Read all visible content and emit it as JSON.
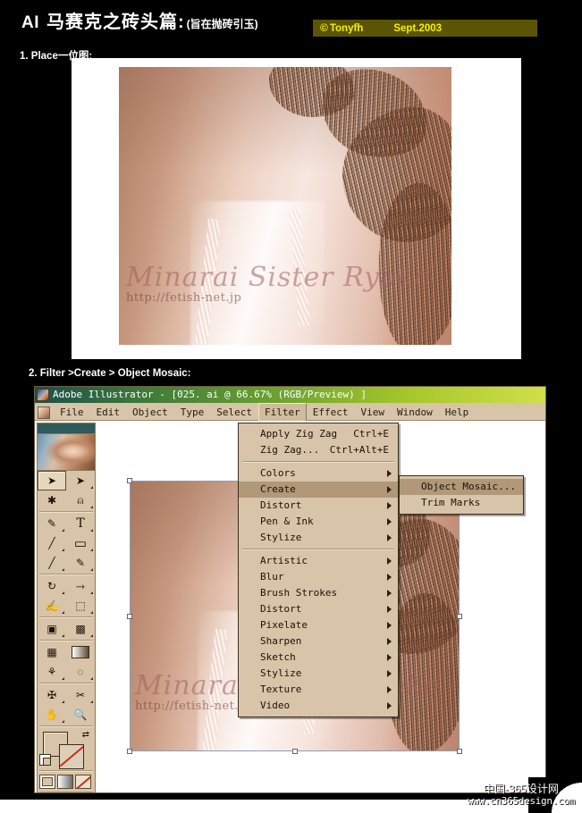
{
  "header": {
    "ai_tag": "AI",
    "title_cn": "马赛克之砖头篇:",
    "subtitle_cn": "(旨在抛砖引玉)",
    "copyright_mark": "©",
    "copyright_owner": "Tonyfh",
    "copyright_date": "Sept.2003",
    "badge_bg": "#5b5405",
    "badge_fg": "#f5f000"
  },
  "sections": {
    "step1_label": "1. Place一位图:",
    "step2_label": "2. Filter >Create > Object  Mosaic:"
  },
  "photo": {
    "watermark_name": "Minarai Sister Ryoko",
    "watermark_url": "http://fetish-net.jp"
  },
  "ai_window": {
    "title": "Adobe Illustrator - [025. ai @ 66.67% (RGB/Preview) ]",
    "titlebar_gradient_start": "#1d4f4a",
    "titlebar_gradient_end": "#cfe04a",
    "menubar": [
      {
        "label": "File",
        "active": false
      },
      {
        "label": "Edit",
        "active": false
      },
      {
        "label": "Object",
        "active": false
      },
      {
        "label": "Type",
        "active": false
      },
      {
        "label": "Select",
        "active": false
      },
      {
        "label": "Filter",
        "active": true
      },
      {
        "label": "Effect",
        "active": false
      },
      {
        "label": "View",
        "active": false
      },
      {
        "label": "Window",
        "active": false
      },
      {
        "label": "Help",
        "active": false
      }
    ],
    "zoom_level": "66.67%",
    "document_name": "025. ai",
    "color_mode": "RGB/Preview"
  },
  "filter_menu": {
    "groups": [
      [
        {
          "label": "Apply Zig Zag",
          "shortcut": "Ctrl+E",
          "submenu": false,
          "highlighted": false
        },
        {
          "label": "Zig Zag...",
          "shortcut": "Ctrl+Alt+E",
          "submenu": false,
          "highlighted": false
        }
      ],
      [
        {
          "label": "Colors",
          "shortcut": "",
          "submenu": true,
          "highlighted": false
        },
        {
          "label": "Create",
          "shortcut": "",
          "submenu": true,
          "highlighted": true
        },
        {
          "label": "Distort",
          "shortcut": "",
          "submenu": true,
          "highlighted": false
        },
        {
          "label": "Pen & Ink",
          "shortcut": "",
          "submenu": true,
          "highlighted": false
        },
        {
          "label": "Stylize",
          "shortcut": "",
          "submenu": true,
          "highlighted": false
        }
      ],
      [
        {
          "label": "Artistic",
          "shortcut": "",
          "submenu": true,
          "highlighted": false
        },
        {
          "label": "Blur",
          "shortcut": "",
          "submenu": true,
          "highlighted": false
        },
        {
          "label": "Brush Strokes",
          "shortcut": "",
          "submenu": true,
          "highlighted": false
        },
        {
          "label": "Distort",
          "shortcut": "",
          "submenu": true,
          "highlighted": false
        },
        {
          "label": "Pixelate",
          "shortcut": "",
          "submenu": true,
          "highlighted": false
        },
        {
          "label": "Sharpen",
          "shortcut": "",
          "submenu": true,
          "highlighted": false
        },
        {
          "label": "Sketch",
          "shortcut": "",
          "submenu": true,
          "highlighted": false
        },
        {
          "label": "Stylize",
          "shortcut": "",
          "submenu": true,
          "highlighted": false
        },
        {
          "label": "Texture",
          "shortcut": "",
          "submenu": true,
          "highlighted": false
        },
        {
          "label": "Video",
          "shortcut": "",
          "submenu": true,
          "highlighted": false
        }
      ]
    ]
  },
  "create_submenu": {
    "items": [
      {
        "label": "Object Mosaic...",
        "highlighted": true
      },
      {
        "label": "Trim Marks",
        "highlighted": false
      }
    ]
  },
  "toolbox": {
    "rows": [
      [
        {
          "name": "selection-tool",
          "glyph": "➤",
          "selected": true,
          "corner": false
        },
        {
          "name": "direct-selection-tool",
          "glyph": "➤",
          "selected": false,
          "corner": true
        }
      ],
      [
        {
          "name": "magic-wand-tool",
          "glyph": "✳",
          "selected": false,
          "corner": false
        },
        {
          "name": "lasso-tool",
          "glyph": "◠",
          "selected": false,
          "corner": true
        }
      ],
      [
        {
          "name": "pen-tool",
          "glyph": "✒",
          "selected": false,
          "corner": true
        },
        {
          "name": "type-tool",
          "glyph": "T",
          "selected": false,
          "corner": true
        }
      ],
      [
        {
          "name": "line-segment-tool",
          "glyph": "╱",
          "selected": false,
          "corner": true
        },
        {
          "name": "rectangle-tool",
          "glyph": "▭",
          "selected": false,
          "corner": true
        }
      ],
      [
        {
          "name": "paintbrush-tool",
          "glyph": "🖌",
          "selected": false,
          "corner": true
        },
        {
          "name": "pencil-tool",
          "glyph": "✎",
          "selected": false,
          "corner": true
        }
      ],
      [
        {
          "name": "rotate-tool",
          "glyph": "↻",
          "selected": false,
          "corner": true
        },
        {
          "name": "scale-tool",
          "glyph": "⤡",
          "selected": false,
          "corner": true
        }
      ],
      [
        {
          "name": "warp-tool",
          "glyph": "✋",
          "selected": false,
          "corner": true
        },
        {
          "name": "free-transform-tool",
          "glyph": "⬚",
          "selected": false,
          "corner": true
        }
      ],
      [
        {
          "name": "symbol-sprayer-tool",
          "glyph": "⛉",
          "selected": false,
          "corner": true
        },
        {
          "name": "column-graph-tool",
          "glyph": "▥",
          "selected": false,
          "corner": true
        }
      ],
      [
        {
          "name": "mesh-tool",
          "glyph": "▦",
          "selected": false,
          "corner": false
        },
        {
          "name": "gradient-tool",
          "glyph": "▬",
          "selected": false,
          "corner": false
        }
      ],
      [
        {
          "name": "eyedropper-tool",
          "glyph": "⚲",
          "selected": false,
          "corner": true
        },
        {
          "name": "blend-tool",
          "glyph": "◌",
          "selected": false,
          "corner": true
        }
      ],
      [
        {
          "name": "slice-tool",
          "glyph": "✂",
          "selected": false,
          "corner": true
        },
        {
          "name": "scissors-tool",
          "glyph": "✂",
          "selected": false,
          "corner": true
        }
      ],
      [
        {
          "name": "hand-tool",
          "glyph": "✋",
          "selected": false,
          "corner": true
        },
        {
          "name": "zoom-tool",
          "glyph": "🔍",
          "selected": false,
          "corner": false
        }
      ]
    ]
  },
  "footer": {
    "watermark_line1": "中国-365设计网",
    "watermark_line2": "www.cn365design.com"
  }
}
